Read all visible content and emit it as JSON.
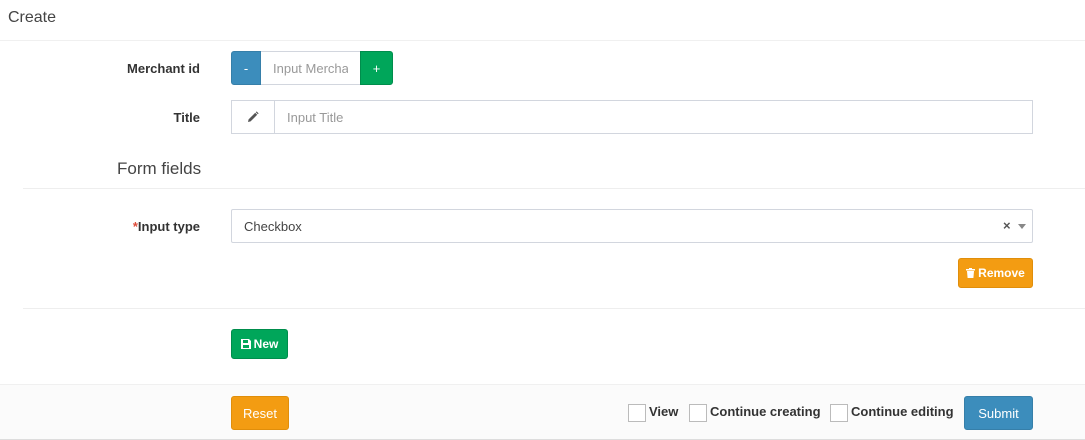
{
  "header": {
    "title": "Create"
  },
  "merchant": {
    "label": "Merchant id",
    "minus_label": "-",
    "plus_label": "+",
    "placeholder": "Input Merchant id",
    "value": ""
  },
  "title_field": {
    "label": "Title",
    "placeholder": "Input Title",
    "value": "",
    "icon": "pencil-icon"
  },
  "form_fields": {
    "section_title": "Form fields",
    "required_marker": "*",
    "input_type_label": "Input type",
    "input_type_value": "Checkbox",
    "clear_symbol": "×",
    "remove_label": "Remove",
    "remove_icon": "trash-icon",
    "new_label": "New",
    "new_icon": "save-icon"
  },
  "footer": {
    "reset_label": "Reset",
    "view_label": "View",
    "continue_creating_label": "Continue creating",
    "continue_editing_label": "Continue editing",
    "submit_label": "Submit"
  },
  "colors": {
    "primary": "#3c8dbc",
    "success": "#00a65a",
    "warning": "#f39c12",
    "danger": "#dd4b39"
  }
}
